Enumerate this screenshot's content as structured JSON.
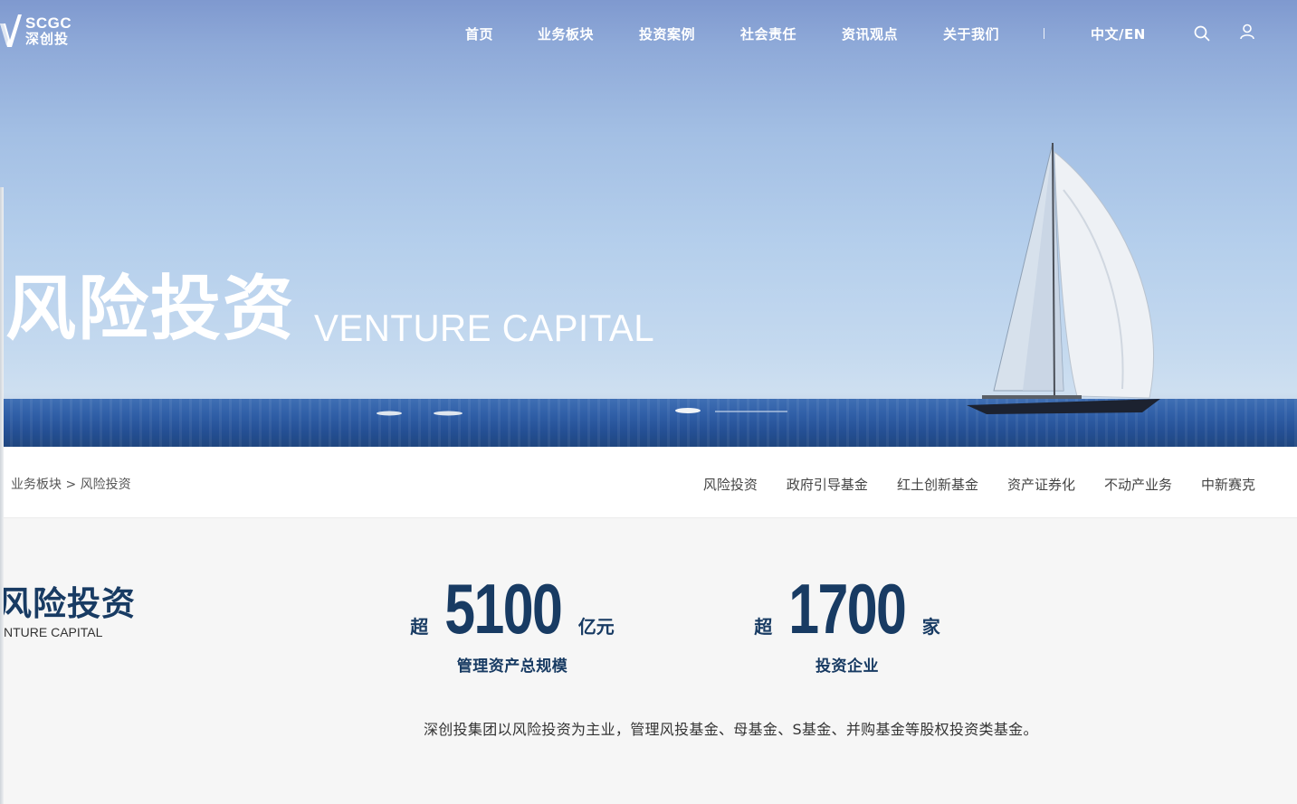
{
  "brand": {
    "logo_en": "SCGC",
    "logo_cn": "深创投"
  },
  "nav": {
    "items": [
      "首页",
      "业务板块",
      "投资案例",
      "社会责任",
      "资讯观点",
      "关于我们"
    ],
    "language": "中文/EN",
    "search_icon": "search-icon",
    "user_icon": "user-icon"
  },
  "hero": {
    "title": "风险投资",
    "subtitle": "VENTURE CAPITAL"
  },
  "breadcrumb": {
    "parent": "业务板块",
    "separator": ">",
    "current": "风险投资"
  },
  "subnav": {
    "items": [
      "风险投资",
      "政府引导基金",
      "红土创新基金",
      "资产证券化",
      "不动产业务",
      "中新赛克"
    ]
  },
  "section": {
    "title": "风险投资",
    "subtitle": "NTURE CAPITAL"
  },
  "stats": [
    {
      "prefix": "超",
      "value": "5100",
      "unit": "亿元",
      "label": "管理资产总规模"
    },
    {
      "prefix": "超",
      "value": "1700",
      "unit": "家",
      "label": "投资企业"
    }
  ],
  "description": "深创投集团以风险投资为主业，管理风投基金、母基金、S基金、并购基金等股权投资类基金。",
  "colors": {
    "brand_navy": "#183b63",
    "text_gray": "#444444",
    "background": "#f6f6f6"
  }
}
